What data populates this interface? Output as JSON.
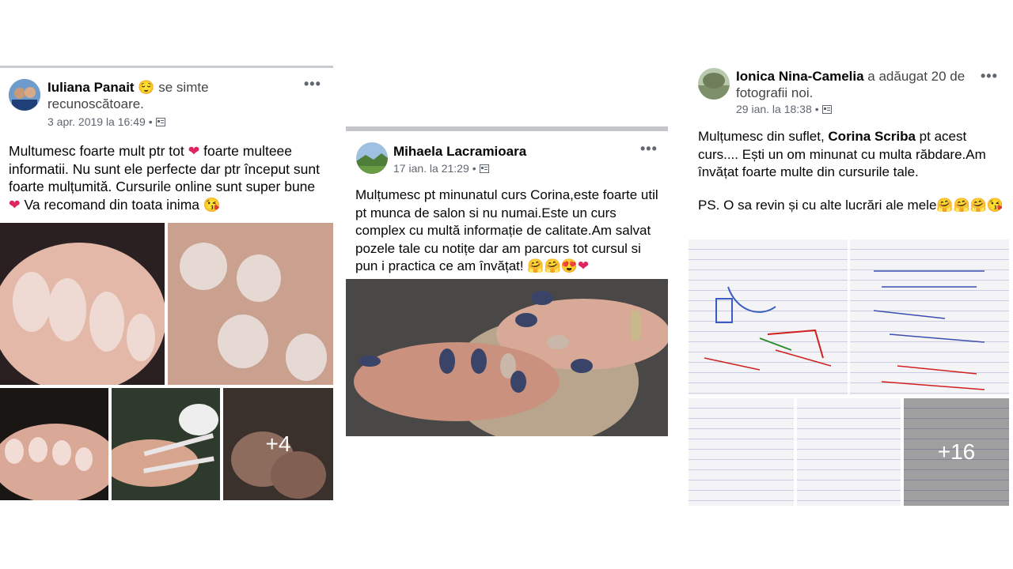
{
  "posts": [
    {
      "author": "Iuliana Panait",
      "feeling_emoji": "😌",
      "action": "se simte recunoscătoare.",
      "timestamp": "3 apr. 2019 la 16:49",
      "separator": "•",
      "text_line1": "Multumesc foarte mult ptr tot ",
      "text_line1b": " foarte multeee informatii. Nu sunt ele perfecte dar ptr început sunt foarte mulțumită. Cursurile online sunt super bune ",
      "text_line1c": "  Va recomand din toata inima ",
      "heart": "❤",
      "kiss_emoji": "😘",
      "more_count": "+4"
    },
    {
      "author": "Mihaela Lacramioara",
      "timestamp": "17 ian. la 21:29",
      "separator": "•",
      "text": "Mulțumesc pt minunatul curs Corina,este foarte util pt munca de salon si nu numai.Este un curs complex cu multă informație de calitate.Am salvat pozele tale cu notițe dar am parcurs tot cursul si pun i  practica ce am învățat! ",
      "emojis": "🤗🤗😍",
      "heart": "❤"
    },
    {
      "author": "Ionica Nina-Camelia",
      "action": "a adăugat 20 de fotografii noi.",
      "timestamp": "29 ian. la 18:38",
      "separator": "•",
      "text_a": "Mulțumesc din suflet, ",
      "mention": "Corina Scriba",
      "text_b": " pt acest curs.... Ești un om minunat cu multa răbdare.Am învățat foarte multe din cursurile tale.",
      "ps_text": "PS. O sa revin și cu alte lucrări ale mele",
      "ps_emojis": "🤗🤗🤗",
      "ps_kiss": "😘",
      "more_count": "+16"
    }
  ],
  "more_label": "•••",
  "colors": {
    "heart": "#e0245e",
    "nail_polish": "#3a4468",
    "paper": "#f4f4f6"
  }
}
